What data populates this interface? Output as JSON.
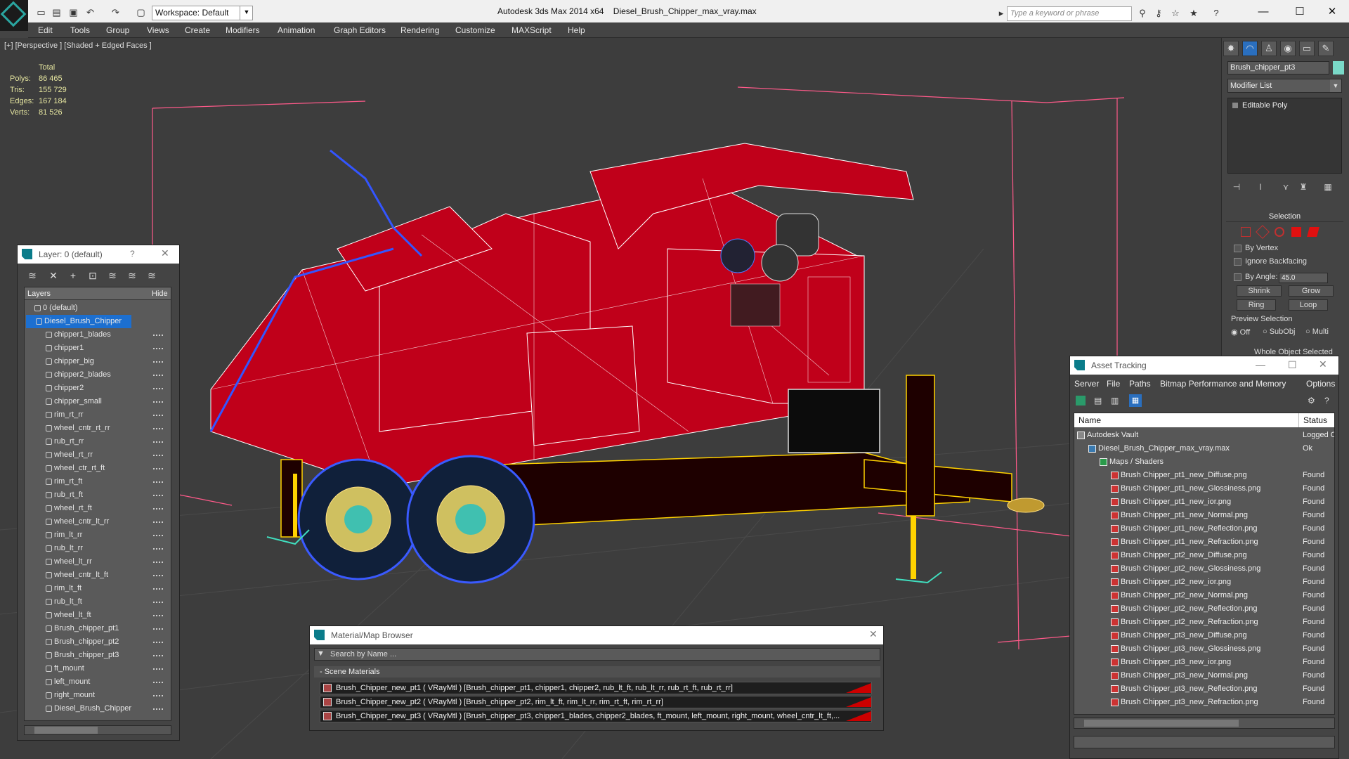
{
  "titlebar": {
    "workspace": "Workspace: Default",
    "app_name": "Autodesk 3ds Max  2014 x64",
    "file_name": "Diesel_Brush_Chipper_max_vray.max",
    "search_placeholder": "Type a keyword or phrase"
  },
  "menu": [
    "Edit",
    "Tools",
    "Group",
    "Views",
    "Create",
    "Modifiers",
    "Animation",
    "Graph Editors",
    "Rendering",
    "Customize",
    "MAXScript",
    "Help"
  ],
  "viewport": {
    "label": "[+] [Perspective ] [Shaded + Edged Faces ]",
    "stats_header": "Total",
    "stats": [
      {
        "key": "Polys:",
        "value": "86 465"
      },
      {
        "key": "Tris:",
        "value": "155 729"
      },
      {
        "key": "Edges:",
        "value": "167 184"
      },
      {
        "key": "Verts:",
        "value": "81 526"
      }
    ]
  },
  "command_panel": {
    "object_name": "Brush_chipper_pt3",
    "modifier_list": "Modifier List",
    "stack_item": "Editable Poly",
    "selection_title": "Selection",
    "by_vertex": "By Vertex",
    "ignore_backfacing": "Ignore Backfacing",
    "by_angle": "By Angle:",
    "angle_value": "45.0",
    "shrink": "Shrink",
    "grow": "Grow",
    "ring": "Ring",
    "loop": "Loop",
    "preview_selection": "Preview Selection",
    "preview_options": [
      "Off",
      "SubObj",
      "Multi"
    ],
    "whole_object": "Whole Object Selected"
  },
  "layer_panel": {
    "title": "Layer: 0 (default)",
    "help": "?",
    "col_layers": "Layers",
    "col_hide": "Hide",
    "items": [
      {
        "label": "0 (default)",
        "level": 0
      },
      {
        "label": "Diesel_Brush_Chipper",
        "level": 0
      },
      {
        "label": "chipper1_blades",
        "level": 1
      },
      {
        "label": "chipper1",
        "level": 1
      },
      {
        "label": "chipper_big",
        "level": 1
      },
      {
        "label": "chipper2_blades",
        "level": 1
      },
      {
        "label": "chipper2",
        "level": 1
      },
      {
        "label": "chipper_small",
        "level": 1
      },
      {
        "label": "rim_rt_rr",
        "level": 1
      },
      {
        "label": "wheel_cntr_rt_rr",
        "level": 1
      },
      {
        "label": "rub_rt_rr",
        "level": 1
      },
      {
        "label": "wheel_rt_rr",
        "level": 1
      },
      {
        "label": "wheel_ctr_rt_ft",
        "level": 1
      },
      {
        "label": "rim_rt_ft",
        "level": 1
      },
      {
        "label": "rub_rt_ft",
        "level": 1
      },
      {
        "label": "wheel_rt_ft",
        "level": 1
      },
      {
        "label": "wheel_cntr_lt_rr",
        "level": 1
      },
      {
        "label": "rim_lt_rr",
        "level": 1
      },
      {
        "label": "rub_lt_rr",
        "level": 1
      },
      {
        "label": "wheel_lt_rr",
        "level": 1
      },
      {
        "label": "wheel_cntr_lt_ft",
        "level": 1
      },
      {
        "label": "rim_lt_ft",
        "level": 1
      },
      {
        "label": "rub_lt_ft",
        "level": 1
      },
      {
        "label": "wheel_lt_ft",
        "level": 1
      },
      {
        "label": "Brush_chipper_pt1",
        "level": 1
      },
      {
        "label": "Brush_chipper_pt2",
        "level": 1
      },
      {
        "label": "Brush_chipper_pt3",
        "level": 1
      },
      {
        "label": "ft_mount",
        "level": 1
      },
      {
        "label": "left_mount",
        "level": 1
      },
      {
        "label": "right_mount",
        "level": 1
      },
      {
        "label": "Diesel_Brush_Chipper",
        "level": 1
      }
    ]
  },
  "material_browser": {
    "title": "Material/Map Browser",
    "search_placeholder": "Search by Name ...",
    "section": "- Scene Materials",
    "items": [
      "Brush_Chipper_new_pt1  ( VRayMtl )  [Brush_chipper_pt1, chipper1, chipper2, rub_lt_ft, rub_lt_rr, rub_rt_ft, rub_rt_rr]",
      "Brush_Chipper_new_pt2  ( VRayMtl )  [Brush_chipper_pt2, rim_lt_ft, rim_lt_rr, rim_rt_ft, rim_rt_rr]",
      "Brush_Chipper_new_pt3  ( VRayMtl )  [Brush_chipper_pt3, chipper1_blades, chipper2_blades, ft_mount, left_mount, right_mount, wheel_cntr_lt_ft,..."
    ]
  },
  "asset_tracking": {
    "title": "Asset Tracking",
    "menu": [
      "Server",
      "File",
      "Paths",
      "Bitmap Performance and Memory",
      "Options"
    ],
    "col_name": "Name",
    "col_status": "Status",
    "rows": [
      {
        "name": "Autodesk Vault",
        "status": "Logged O",
        "level": 0
      },
      {
        "name": "Diesel_Brush_Chipper_max_vray.max",
        "status": "Ok",
        "level": 1
      },
      {
        "name": "Maps / Shaders",
        "status": "",
        "level": 2
      },
      {
        "name": "Brush Chipper_pt1_new_Diffuse.png",
        "status": "Found",
        "level": 3
      },
      {
        "name": "Brush Chipper_pt1_new_Glossiness.png",
        "status": "Found",
        "level": 3
      },
      {
        "name": "Brush Chipper_pt1_new_ior.png",
        "status": "Found",
        "level": 3
      },
      {
        "name": "Brush Chipper_pt1_new_Normal.png",
        "status": "Found",
        "level": 3
      },
      {
        "name": "Brush Chipper_pt1_new_Reflection.png",
        "status": "Found",
        "level": 3
      },
      {
        "name": "Brush Chipper_pt1_new_Refraction.png",
        "status": "Found",
        "level": 3
      },
      {
        "name": "Brush Chipper_pt2_new_Diffuse.png",
        "status": "Found",
        "level": 3
      },
      {
        "name": "Brush Chipper_pt2_new_Glossiness.png",
        "status": "Found",
        "level": 3
      },
      {
        "name": "Brush Chipper_pt2_new_ior.png",
        "status": "Found",
        "level": 3
      },
      {
        "name": "Brush Chipper_pt2_new_Normal.png",
        "status": "Found",
        "level": 3
      },
      {
        "name": "Brush Chipper_pt2_new_Reflection.png",
        "status": "Found",
        "level": 3
      },
      {
        "name": "Brush Chipper_pt2_new_Refraction.png",
        "status": "Found",
        "level": 3
      },
      {
        "name": "Brush Chipper_pt3_new_Diffuse.png",
        "status": "Found",
        "level": 3
      },
      {
        "name": "Brush Chipper_pt3_new_Glossiness.png",
        "status": "Found",
        "level": 3
      },
      {
        "name": "Brush Chipper_pt3_new_ior.png",
        "status": "Found",
        "level": 3
      },
      {
        "name": "Brush Chipper_pt3_new_Normal.png",
        "status": "Found",
        "level": 3
      },
      {
        "name": "Brush Chipper_pt3_new_Reflection.png",
        "status": "Found",
        "level": 3
      },
      {
        "name": "Brush Chipper_pt3_new_Refraction.png",
        "status": "Found",
        "level": 3
      }
    ]
  },
  "colors": {
    "accent": "#2aa5a0",
    "selected": "#1c6fd0",
    "model_red": "#c0001a",
    "stats_yellow": "#e6e6a0"
  }
}
